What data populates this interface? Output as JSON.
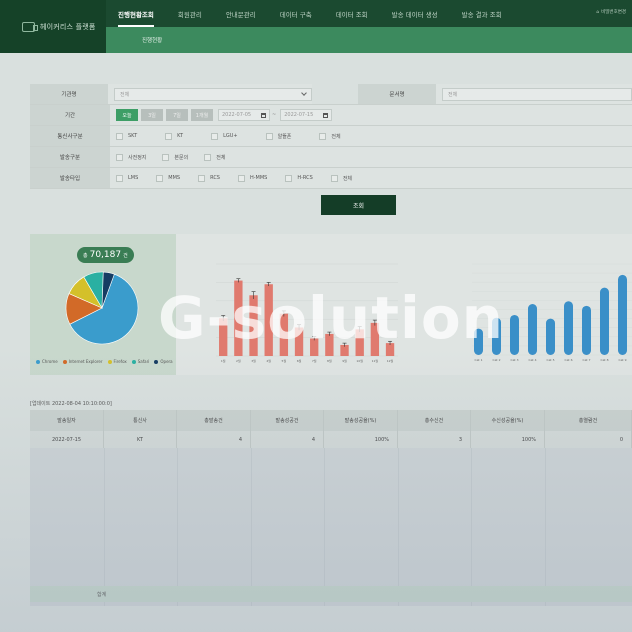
{
  "brand": {
    "name": "헤이커리스 플랫폼",
    "icon": "chat-bubbles-icon"
  },
  "nav": {
    "items": [
      "진행현황조회",
      "회원관리",
      "안내문관리",
      "데이터 구축",
      "데이터 조회",
      "발송 데이터 생성",
      "발송 결과 조회"
    ],
    "active_index": 0,
    "right_text": "비밀번호변경"
  },
  "subnav": {
    "active": "진행현황"
  },
  "filters": {
    "org_label": "기관명",
    "org_value": "전체",
    "doc_label": "문서명",
    "doc_value": "전체",
    "period_label": "기간",
    "period_buttons": [
      "오늘",
      "3일",
      "7일",
      "1개월"
    ],
    "period_active": "오늘",
    "date_from": "2022-07-05",
    "date_to": "2022-07-15",
    "date_sep": "~",
    "carrier_label": "통신사구분",
    "carrier_options": [
      "SKT",
      "KT",
      "LGU+",
      "알뜰폰",
      "전체"
    ],
    "send_type_label": "발송구분",
    "send_type_options": [
      "사전정지",
      "본문의",
      "전체"
    ],
    "send_kind_label": "발송타입",
    "send_kind_options": [
      "LMS",
      "MMS",
      "RCS",
      "H-MMS",
      "H-RCS",
      "전체"
    ],
    "search_button": "조회"
  },
  "pie": {
    "total_prefix": "총",
    "total": "70,187",
    "total_suffix": "건",
    "colors": {
      "chrome": "#3a9ccc",
      "ie": "#d26a28",
      "firefox": "#d4c02a",
      "safari": "#2ab0a2",
      "opera": "#163d63"
    },
    "legend": [
      "Chrome",
      "Internet Explorer",
      "Firefox",
      "Safari",
      "Opera"
    ]
  },
  "chart_data": [
    {
      "type": "bar",
      "categories": [
        "Chrome",
        "Internet Explorer",
        "Firefox",
        "Safari",
        "Opera"
      ],
      "values": [
        62,
        14,
        10,
        9,
        5
      ]
    },
    {
      "type": "bar",
      "categories": [
        "1월",
        "2월",
        "3월",
        "4월",
        "5월",
        "6월",
        "7월",
        "8월",
        "9월",
        "10월",
        "11월",
        "12월"
      ],
      "values": [
        41,
        82,
        66,
        78,
        46,
        31,
        19,
        24,
        12,
        29,
        36,
        14
      ],
      "error": [
        3,
        2,
        4,
        2,
        3,
        3,
        2,
        2,
        2,
        3,
        3,
        2
      ],
      "ylim": [
        0,
        100
      ]
    },
    {
      "type": "bar",
      "categories": [
        "Cat 1",
        "Cat 2",
        "Cat 3",
        "Cat 4",
        "Cat 5",
        "Cat 6",
        "Cat 7",
        "Cat 8",
        "Cat 9"
      ],
      "values": [
        2.9,
        4.1,
        4.4,
        5.6,
        4.0,
        5.9,
        5.4,
        7.4,
        8.8
      ],
      "ylim": [
        0,
        10
      ]
    }
  ],
  "update": "[업데이트  2022-08-04 10:10:00:0]",
  "table": {
    "headers": [
      "발송일자",
      "통신사",
      "총발송건",
      "발송성공건",
      "발송성공율(%)",
      "총수신건",
      "수신성공율(%)",
      "총열람건"
    ],
    "rows": [
      [
        "2022-07-15",
        "KT",
        "4",
        "4",
        "100%",
        "3",
        "100%",
        "0"
      ]
    ],
    "total_label": "합계"
  },
  "watermark": "G-solution"
}
